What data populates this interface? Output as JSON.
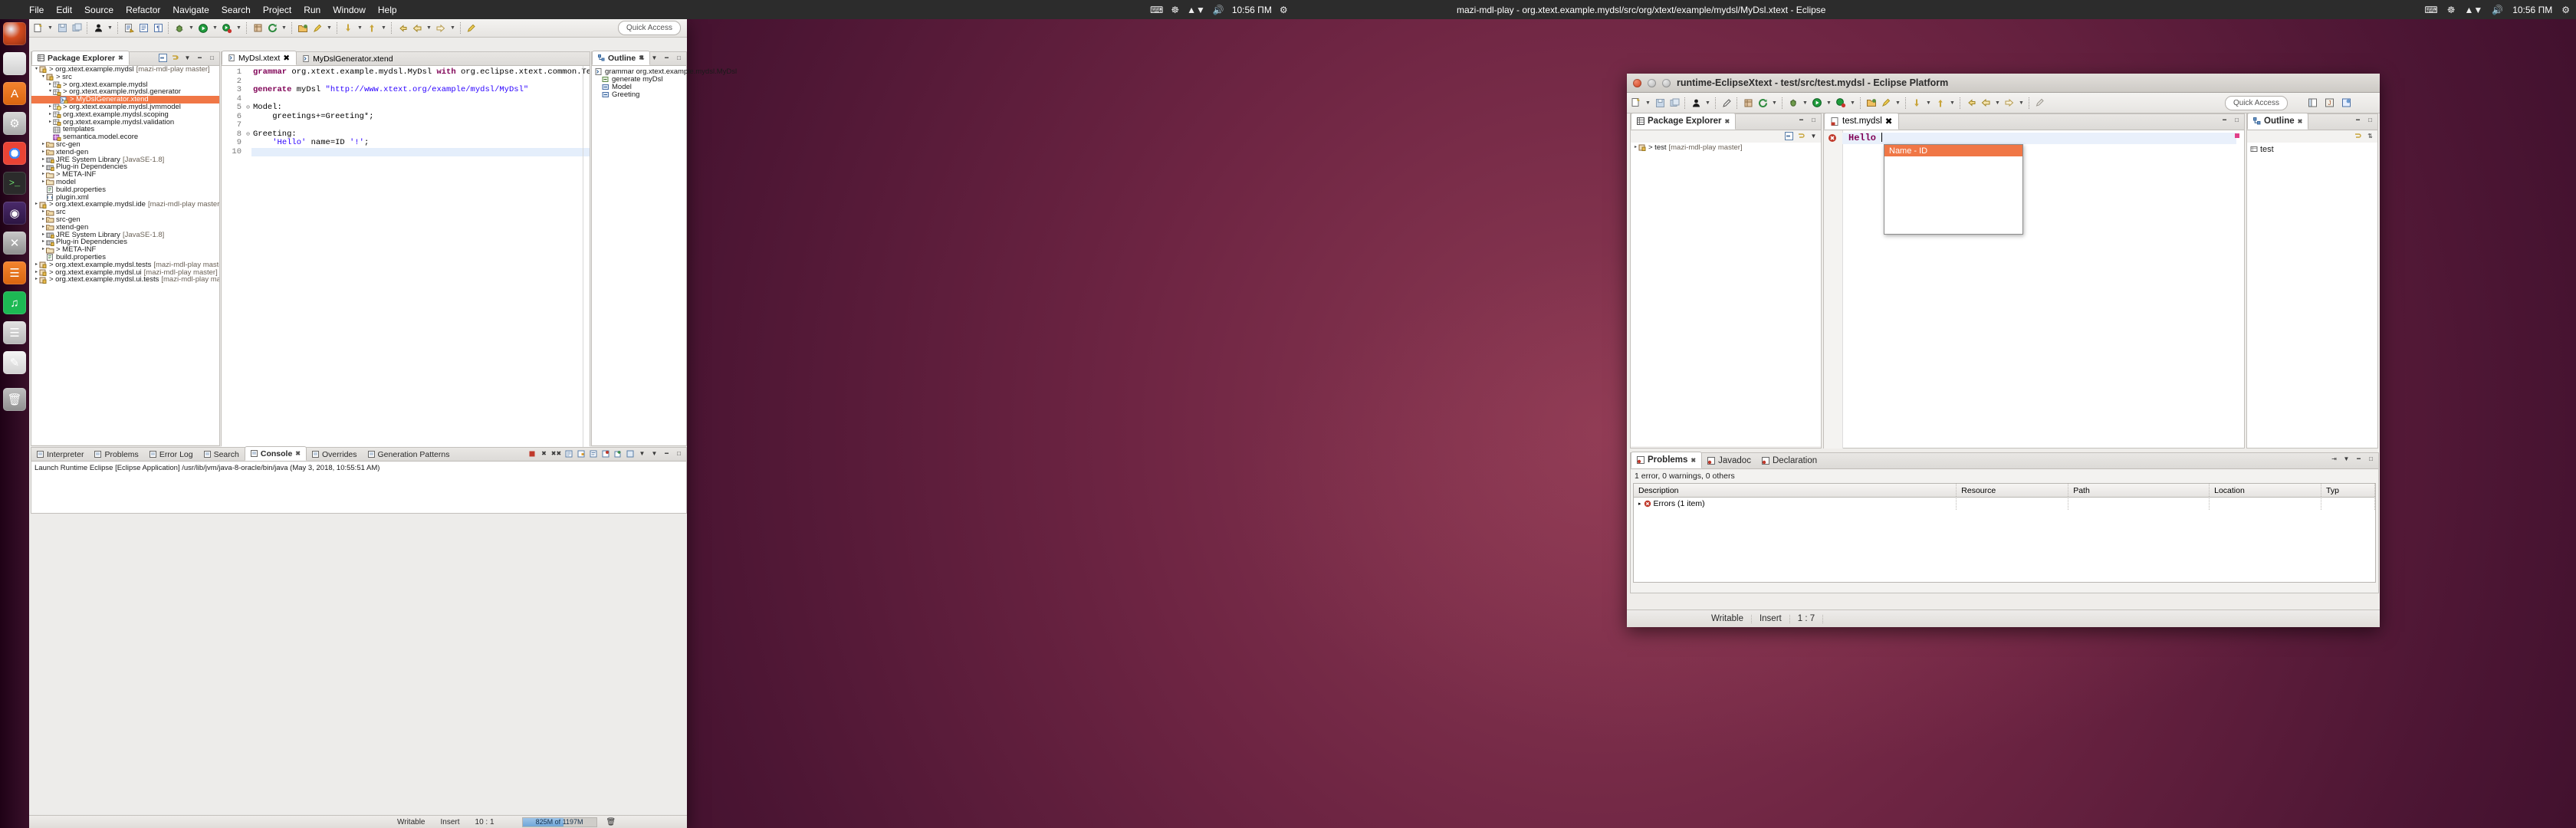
{
  "top_panel": {
    "menu_items": [
      "File",
      "Edit",
      "Source",
      "Refactor",
      "Navigate",
      "Search",
      "Project",
      "Run",
      "Window",
      "Help"
    ],
    "window_title": "mazi-mdl-play - org.xtext.example.mydsl/src/org/xtext/example/mydsl/MyDsl.xtext - Eclipse",
    "clock": "10:56 ΠM",
    "clock_right": "10:56 ΠM",
    "indicators": [
      "network-icon",
      "volume-icon",
      "battery-icon",
      "keyboard-icon",
      "power-icon"
    ]
  },
  "launcher": {
    "items": [
      {
        "name": "ubuntu-dash",
        "label": "Dash home"
      },
      {
        "name": "files",
        "label": "Files"
      },
      {
        "name": "amazon",
        "label": "Amazon"
      },
      {
        "name": "software-center",
        "label": "Ubuntu Software"
      },
      {
        "name": "settings",
        "label": "System Settings"
      },
      {
        "name": "chrome",
        "label": "Google Chrome"
      },
      {
        "name": "terminal",
        "label": "Terminal"
      },
      {
        "name": "eclipse",
        "label": "Eclipse"
      },
      {
        "name": "tool",
        "label": "Tool"
      },
      {
        "name": "spotify",
        "label": "Spotify"
      },
      {
        "name": "bars",
        "label": "Bars"
      },
      {
        "name": "notes",
        "label": "Notes"
      },
      {
        "name": "trash",
        "label": "Trash"
      }
    ]
  },
  "main_window": {
    "title": "mazi-mdl-play - org.xtext.example.mydsl/src/org/xtext/example/mydsl/MyDsl.xtext - Eclipse",
    "quick_access": "Quick Access",
    "package_explorer": {
      "tab_label": "Package Explorer",
      "tree": [
        {
          "indent": 0,
          "twisty": "▾",
          "icon": "project-icon",
          "text": "> org.xtext.example.mydsl",
          "suffix": "[mazi-mdl-play master]"
        },
        {
          "indent": 1,
          "twisty": "▾",
          "icon": "source-folder-icon",
          "text": "> src",
          "suffix": ""
        },
        {
          "indent": 2,
          "twisty": "▸",
          "icon": "package-icon",
          "text": "> org.xtext.example.mydsl",
          "suffix": ""
        },
        {
          "indent": 2,
          "twisty": "▾",
          "icon": "package-icon",
          "text": "> org.xtext.example.mydsl.generator",
          "suffix": ""
        },
        {
          "indent": 3,
          "twisty": "",
          "icon": "xtend-file-icon",
          "text": "> MyDslGenerator.xtend",
          "suffix": "",
          "selected": true
        },
        {
          "indent": 2,
          "twisty": "▸",
          "icon": "package-warn-icon",
          "text": "> org.xtext.example.mydsl.jvmmodel",
          "suffix": ""
        },
        {
          "indent": 2,
          "twisty": "▸",
          "icon": "package-icon",
          "text": "org.xtext.example.mydsl.scoping",
          "suffix": ""
        },
        {
          "indent": 2,
          "twisty": "▸",
          "icon": "package-icon",
          "text": "org.xtext.example.mydsl.validation",
          "suffix": ""
        },
        {
          "indent": 2,
          "twisty": "",
          "icon": "templates-icon",
          "text": "templates",
          "suffix": ""
        },
        {
          "indent": 2,
          "twisty": "",
          "icon": "ecore-icon",
          "text": "semantica.model.ecore",
          "suffix": ""
        },
        {
          "indent": 1,
          "twisty": "▸",
          "icon": "folder-src-icon",
          "text": "src-gen",
          "suffix": ""
        },
        {
          "indent": 1,
          "twisty": "▸",
          "icon": "folder-src-icon",
          "text": "xtend-gen",
          "suffix": ""
        },
        {
          "indent": 1,
          "twisty": "▸",
          "icon": "library-icon",
          "text": "JRE System Library",
          "suffix": "[JavaSE-1.8]"
        },
        {
          "indent": 1,
          "twisty": "▸",
          "icon": "library-icon",
          "text": "Plug-in Dependencies",
          "suffix": ""
        },
        {
          "indent": 1,
          "twisty": "▸",
          "icon": "folder-icon",
          "text": "> META-INF",
          "suffix": ""
        },
        {
          "indent": 1,
          "twisty": "▸",
          "icon": "folder-icon",
          "text": "model",
          "suffix": ""
        },
        {
          "indent": 1,
          "twisty": "",
          "icon": "properties-icon",
          "text": "build.properties",
          "suffix": ""
        },
        {
          "indent": 1,
          "twisty": "",
          "icon": "xml-icon",
          "text": "plugin.xml",
          "suffix": ""
        },
        {
          "indent": 0,
          "twisty": "▸",
          "icon": "project-icon",
          "text": "> org.xtext.example.mydsl.ide",
          "suffix": "[mazi-mdl-play master]"
        },
        {
          "indent": 1,
          "twisty": "▸",
          "icon": "folder-src-icon",
          "text": "src",
          "suffix": ""
        },
        {
          "indent": 1,
          "twisty": "▸",
          "icon": "folder-src-icon",
          "text": "src-gen",
          "suffix": ""
        },
        {
          "indent": 1,
          "twisty": "▸",
          "icon": "folder-src-icon",
          "text": "xtend-gen",
          "suffix": ""
        },
        {
          "indent": 1,
          "twisty": "▸",
          "icon": "library-icon",
          "text": "JRE System Library",
          "suffix": "[JavaSE-1.8]"
        },
        {
          "indent": 1,
          "twisty": "▸",
          "icon": "library-icon",
          "text": "Plug-in Dependencies",
          "suffix": ""
        },
        {
          "indent": 1,
          "twisty": "▸",
          "icon": "folder-icon",
          "text": "> META-INF",
          "suffix": ""
        },
        {
          "indent": 1,
          "twisty": "",
          "icon": "properties-icon",
          "text": "build.properties",
          "suffix": ""
        },
        {
          "indent": 0,
          "twisty": "▸",
          "icon": "project-icon",
          "text": "> org.xtext.example.mydsl.tests",
          "suffix": "[mazi-mdl-play master]"
        },
        {
          "indent": 0,
          "twisty": "▸",
          "icon": "project-icon",
          "text": "> org.xtext.example.mydsl.ui",
          "suffix": "[mazi-mdl-play master]"
        },
        {
          "indent": 0,
          "twisty": "▸",
          "icon": "project-icon",
          "text": "> org.xtext.example.mydsl.ui.tests",
          "suffix": "[mazi-mdl-play master]"
        }
      ]
    },
    "editor": {
      "tabs": [
        {
          "label": "MyDsl.xtext",
          "active": true,
          "closable": true
        },
        {
          "label": "MyDslGenerator.xtend",
          "active": false,
          "closable": false
        }
      ],
      "lines": [
        {
          "no": "1",
          "fold": "",
          "segments": [
            {
              "t": "grammar ",
              "c": "kw"
            },
            {
              "t": "org.xtext.example.mydsl.MyDsl ",
              "c": "id"
            },
            {
              "t": "with ",
              "c": "kw"
            },
            {
              "t": "org.eclipse.xtext.common.Terminals",
              "c": "id"
            }
          ]
        },
        {
          "no": "2",
          "fold": "",
          "segments": []
        },
        {
          "no": "3",
          "fold": "",
          "segments": [
            {
              "t": "generate ",
              "c": "kw"
            },
            {
              "t": "myDsl ",
              "c": "id"
            },
            {
              "t": "\"http://www.xtext.org/example/mydsl/MyDsl\"",
              "c": "str"
            }
          ]
        },
        {
          "no": "4",
          "fold": "",
          "segments": []
        },
        {
          "no": "5",
          "fold": "⊖",
          "segments": [
            {
              "t": "Model:",
              "c": "id"
            }
          ]
        },
        {
          "no": "6",
          "fold": "",
          "segments": [
            {
              "t": "    greetings+=Greeting*;",
              "c": "id"
            }
          ]
        },
        {
          "no": "7",
          "fold": "",
          "segments": []
        },
        {
          "no": "8",
          "fold": "⊖",
          "segments": [
            {
              "t": "Greeting:",
              "c": "id"
            }
          ]
        },
        {
          "no": "9",
          "fold": "",
          "segments": [
            {
              "t": "    ",
              "c": "id"
            },
            {
              "t": "'Hello'",
              "c": "str"
            },
            {
              "t": " name=ID ",
              "c": "id"
            },
            {
              "t": "'!'",
              "c": "str"
            },
            {
              "t": ";",
              "c": "id"
            }
          ]
        },
        {
          "no": "10",
          "fold": "",
          "segments": [],
          "current": true
        }
      ]
    },
    "outline": {
      "tab_label": "Outline",
      "items": [
        {
          "indent": 0,
          "icon": "grammar-icon",
          "text": "grammar org.xtext.example.mydsl.MyDsl"
        },
        {
          "indent": 1,
          "icon": "generate-icon",
          "text": "generate myDsl"
        },
        {
          "indent": 1,
          "icon": "rule-icon",
          "text": "Model"
        },
        {
          "indent": 1,
          "icon": "rule-icon",
          "text": "Greeting"
        }
      ]
    },
    "bottom_panel": {
      "tabs": [
        {
          "label": "Interpreter",
          "active": false
        },
        {
          "label": "Problems",
          "active": false
        },
        {
          "label": "Error Log",
          "active": false
        },
        {
          "label": "Search",
          "active": false
        },
        {
          "label": "Console",
          "active": true
        },
        {
          "label": "Overrides",
          "active": false
        },
        {
          "label": "Generation Patterns",
          "active": false
        }
      ],
      "console_line": "Launch Runtime Eclipse [Eclipse Application] /usr/lib/jvm/java-8-oracle/bin/java (May 3, 2018, 10:55:51 AM)"
    },
    "status_bar": {
      "writable": "Writable",
      "insert": "Insert",
      "position": "10 : 1",
      "heap": "825M of 1197M",
      "trash_icon": "trash-icon"
    }
  },
  "runtime_window": {
    "title": "runtime-EclipseXtext - test/src/test.mydsl - Eclipse Platform",
    "quick_access": "Quick Access",
    "package_explorer": {
      "tab_label": "Package Explorer",
      "tree": [
        {
          "indent": 0,
          "twisty": "▸",
          "icon": "project-icon",
          "text": "> test",
          "suffix": "[mazi-mdl-play master]"
        }
      ]
    },
    "editor": {
      "tab_label": "test.mydsl",
      "code_text": "Hello ",
      "error_marker": "error-marker-icon",
      "content_assist": {
        "options": [
          "Name - ID"
        ],
        "selected_index": 0
      }
    },
    "outline": {
      "tab_label": "Outline",
      "items": [
        {
          "indent": 0,
          "icon": "model-icon",
          "text": "test"
        }
      ]
    },
    "problems": {
      "tabs": [
        {
          "label": "Problems",
          "active": true
        },
        {
          "label": "Javadoc",
          "active": false
        },
        {
          "label": "Declaration",
          "active": false
        }
      ],
      "summary": "1 error, 0 warnings, 0 others",
      "columns": [
        "Description",
        "Resource",
        "Path",
        "Location",
        "Typ"
      ],
      "rows": [
        {
          "description": "Errors (1 item)",
          "resource": "",
          "path": "",
          "location": "",
          "type": ""
        }
      ]
    },
    "status_bar": {
      "writable": "Writable",
      "insert": "Insert",
      "position": "1 : 7"
    }
  },
  "colors": {
    "selection": "#f07746",
    "ubuntu_purple": "#2c001e",
    "keyword": "#7f0055",
    "string": "#2a00ff",
    "panel_bg": "#efedea"
  }
}
